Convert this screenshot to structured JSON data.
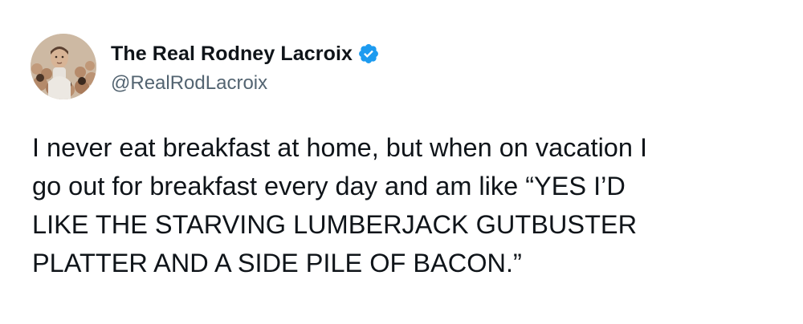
{
  "tweet": {
    "author": {
      "display_name": "The Real Rodney Lacroix",
      "handle": "@RealRodLacroix",
      "avatar_icon": "profile-photo",
      "verified_icon": "verified-badge-icon"
    },
    "text": "I never eat breakfast at home, but when on vacation I\ngo out for breakfast every day and am like “YES I’D\nLIKE THE STARVING LUMBERJACK GUTBUSTER\nPLATTER AND A SIDE PILE OF BACON.”"
  },
  "colors": {
    "text_primary": "#0f1419",
    "text_secondary": "#536471",
    "verified_blue": "#1d9bf0",
    "background": "#ffffff"
  }
}
